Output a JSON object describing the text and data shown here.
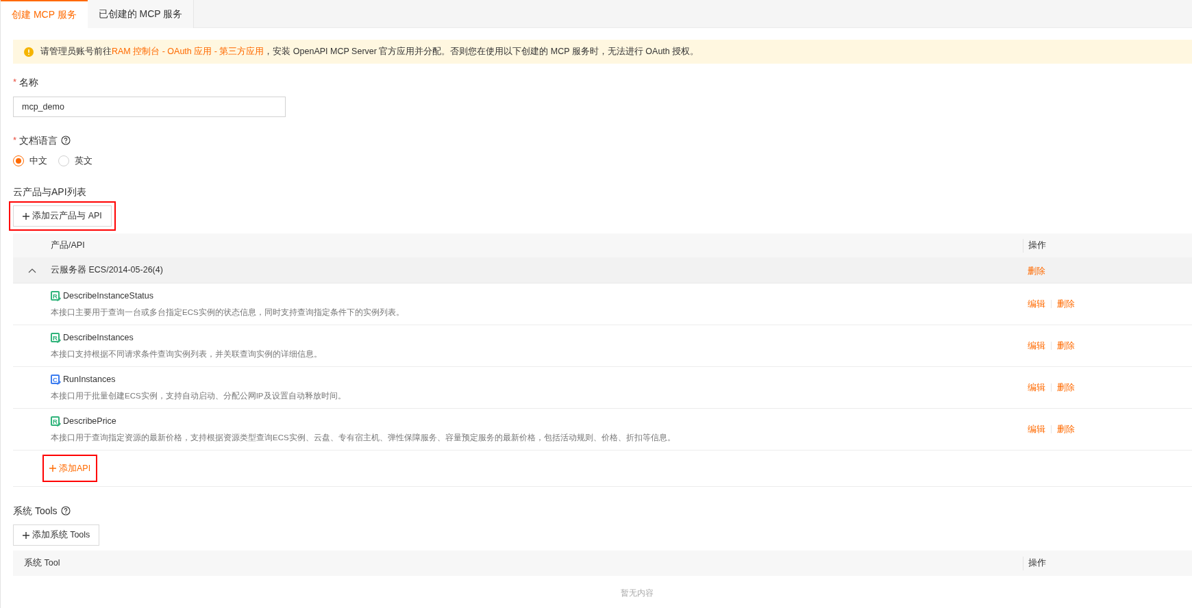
{
  "tabs": [
    {
      "label": "创建 MCP 服务",
      "selected": true
    },
    {
      "label": "已创建的 MCP 服务",
      "selected": false
    }
  ],
  "notice": {
    "before": "请管理员账号前往",
    "link": "RAM 控制台 - OAuth 应用 - 第三方应用",
    "after": "，安装 OpenAPI MCP Server 官方应用并分配。否则您在使用以下创建的 MCP 服务时，无法进行 OAuth 授权。"
  },
  "name_field": {
    "label": "名称",
    "required_mark": "*",
    "value": "mcp_demo"
  },
  "doc_language": {
    "label": "文档语言",
    "required_mark": "*",
    "options": [
      {
        "label": "中文",
        "selected": true
      },
      {
        "label": "英文",
        "selected": false
      }
    ]
  },
  "api_section": {
    "title": "云产品与API列表",
    "add_button": {
      "label": "添加云产品与 API",
      "highlighted": true
    },
    "columns": [
      "产品/API",
      "操作"
    ],
    "group": {
      "name": "云服务器 ECS/2014-05-26(4)",
      "expanded": true,
      "action": "删除"
    },
    "rows": [
      {
        "icon_letter": "R",
        "color": "#2fb37a",
        "name": "DescribeInstanceStatus",
        "description": "本接口主要用于查询一台或多台指定ECS实例的状态信息，同时支持查询指定条件下的实例列表。",
        "actions": [
          "编辑",
          "删除"
        ]
      },
      {
        "icon_letter": "R",
        "color": "#2fb37a",
        "name": "DescribeInstances",
        "description": "本接口支持根据不同请求条件查询实例列表，并关联查询实例的详细信息。",
        "actions": [
          "编辑",
          "删除"
        ]
      },
      {
        "icon_letter": "C",
        "color": "#3b7cf0",
        "name": "RunInstances",
        "description": "本接口用于批量创建ECS实例，支持自动启动、分配公网IP及设置自动释放时间。",
        "actions": [
          "编辑",
          "删除"
        ]
      },
      {
        "icon_letter": "R",
        "color": "#2fb37a",
        "name": "DescribePrice",
        "description": "本接口用于查询指定资源的最新价格，支持根据资源类型查询ECS实例、云盘、专有宿主机、弹性保障服务、容量预定服务的最新价格，包括活动规则、价格、折扣等信息。",
        "actions": [
          "编辑",
          "删除"
        ]
      }
    ],
    "add_api": {
      "label": "添加API",
      "highlighted": true
    }
  },
  "tools_section": {
    "title": "系统 Tools",
    "add_button": {
      "label": "添加系统 Tools",
      "highlighted": false
    },
    "columns": [
      "系统 Tool",
      "操作"
    ],
    "empty_text": "暂无内容"
  }
}
